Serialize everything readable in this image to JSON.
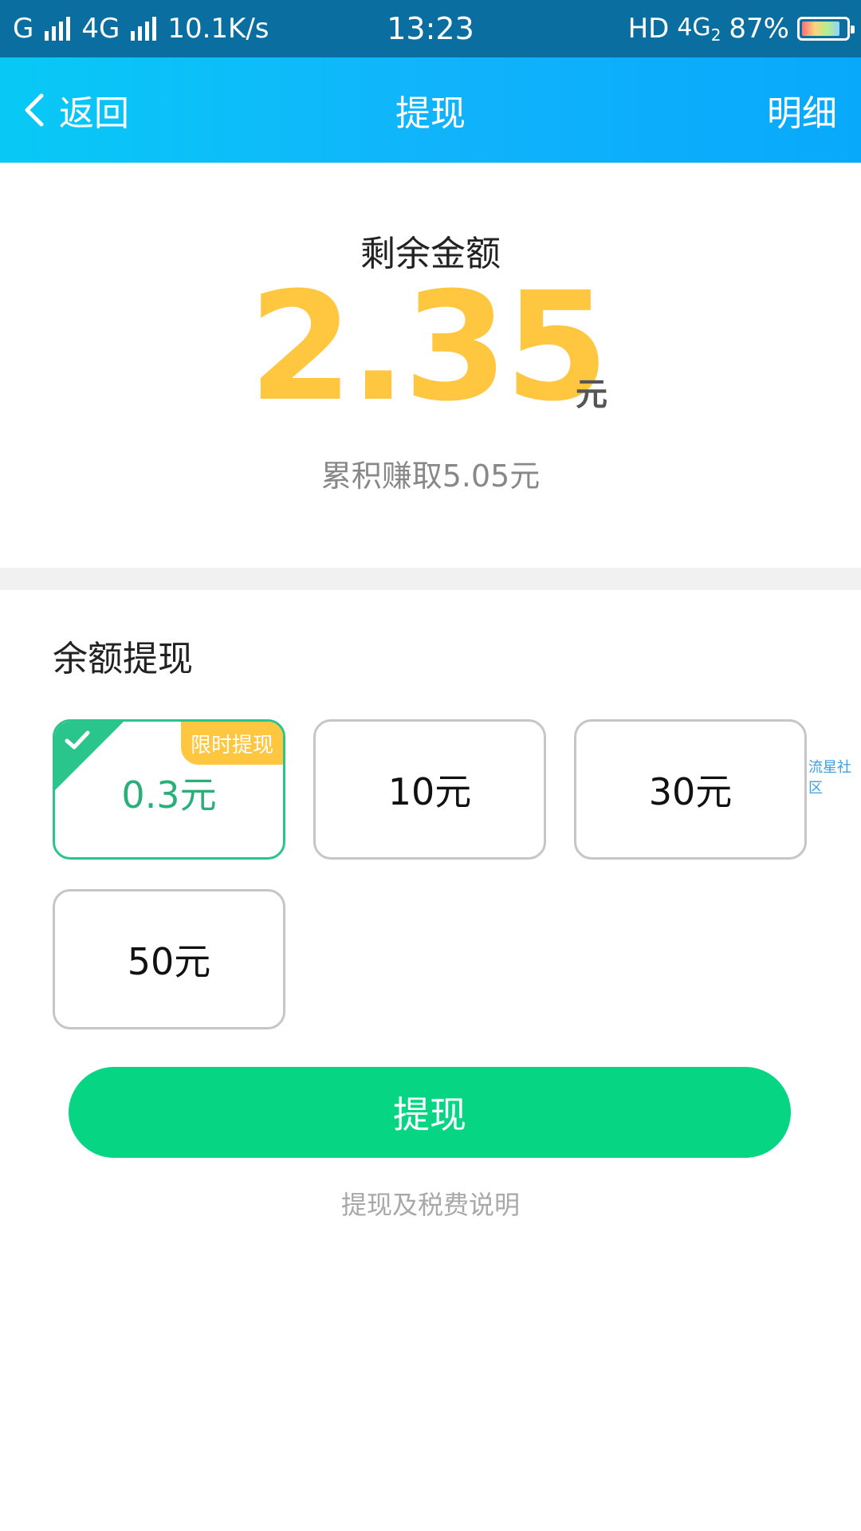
{
  "status_bar": {
    "carrier1": "G",
    "network2": "4G",
    "speed": "10.1K/s",
    "time": "13:23",
    "hd": "HD",
    "lte": "4G",
    "lte_sub": "2",
    "battery": "87%",
    "battery_level": 0.87
  },
  "nav": {
    "back_label": "返回",
    "title": "提现",
    "detail_label": "明细"
  },
  "balance": {
    "label": "剩余金额",
    "amount": "2.35",
    "unit": "元",
    "earned": "累积赚取5.05元"
  },
  "withdraw": {
    "section_title": "余额提现",
    "options": [
      {
        "label": "0.3元",
        "tag": "限时提现",
        "selected": true
      },
      {
        "label": "10元",
        "selected": false
      },
      {
        "label": "30元",
        "selected": false
      },
      {
        "label": "50元",
        "selected": false
      }
    ],
    "button_label": "提现",
    "tax_link": "提现及税费说明"
  },
  "watermark": "流星社区",
  "colors": {
    "accent_green": "#06d584",
    "amount_yellow": "#ffc640",
    "nav_blue": "#10b4fb"
  }
}
